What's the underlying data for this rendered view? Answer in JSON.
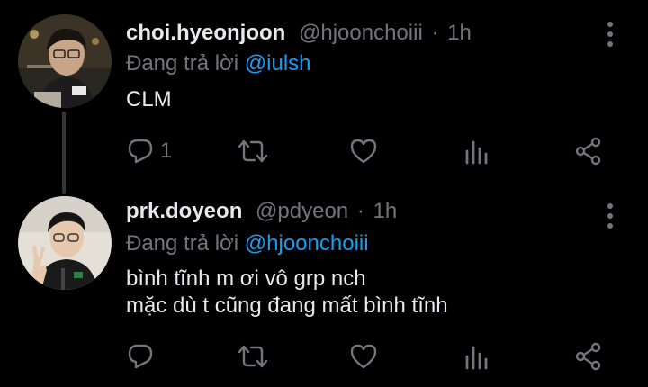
{
  "colors": {
    "background": "#000000",
    "primary_text": "#e7e9ea",
    "secondary_text": "#71767b",
    "accent": "#1d9bf0",
    "thread_line": "#333639"
  },
  "tweets": [
    {
      "display_name": "choi.hyeonjoon",
      "handle": "@hjoonchoiii",
      "separator": "·",
      "time": "1h",
      "reply_prefix": "Đang trả lời",
      "reply_mention": "@iulsh",
      "content_lines": [
        "CLM"
      ],
      "reply_count": "1",
      "avatar_icon": "user-photo"
    },
    {
      "display_name": "prk.doyeon",
      "handle": "@pdyeon",
      "separator": "·",
      "time": "1h",
      "reply_prefix": "Đang trả lời",
      "reply_mention": "@hjoonchoiii",
      "content_lines": [
        "bình tĩnh m ơi vô grp nch",
        "mặc dù t cũng đang mất bình tĩnh"
      ],
      "reply_count": "",
      "avatar_icon": "user-photo"
    }
  ],
  "icons": {
    "reply": "reply-icon",
    "retweet": "retweet-icon",
    "like": "heart-icon",
    "stats": "analytics-icon",
    "share": "share-icon",
    "more": "more-vertical-icon"
  }
}
